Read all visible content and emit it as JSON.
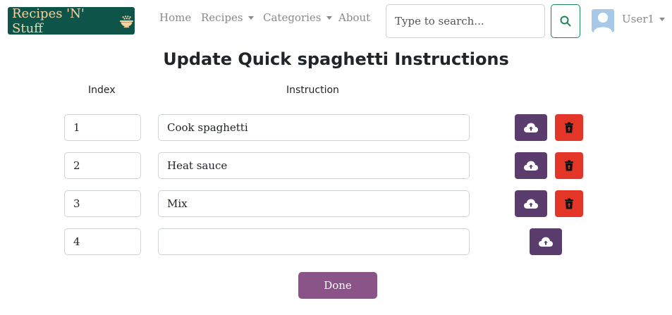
{
  "navbar": {
    "brand": "Recipes 'N' Stuff",
    "brand_icon": "bowl-icon",
    "links": {
      "home": "Home",
      "recipes": "Recipes",
      "categories": "Categories",
      "about": "About"
    },
    "search": {
      "placeholder": "Type to search...",
      "icon": "search-icon"
    },
    "user": {
      "name": "User1",
      "icon": "user-avatar-icon"
    }
  },
  "page": {
    "title": "Update Quick spaghetti Instructions",
    "headers": {
      "index": "Index",
      "instruction": "Instruction"
    },
    "instructions": [
      {
        "index": "1",
        "text": "Cook spaghetti"
      },
      {
        "index": "2",
        "text": "Heat sauce"
      },
      {
        "index": "3",
        "text": "Mix"
      }
    ],
    "new_row": {
      "index": "4",
      "text": ""
    },
    "done_label": "Done"
  },
  "colors": {
    "brand_bg": "#0f5448",
    "brand_text": "#f3d3a4",
    "upload_button": "#5a3d6c",
    "delete_button": "#e33628",
    "done_button": "#8a5488",
    "search_button_border": "#198754"
  }
}
